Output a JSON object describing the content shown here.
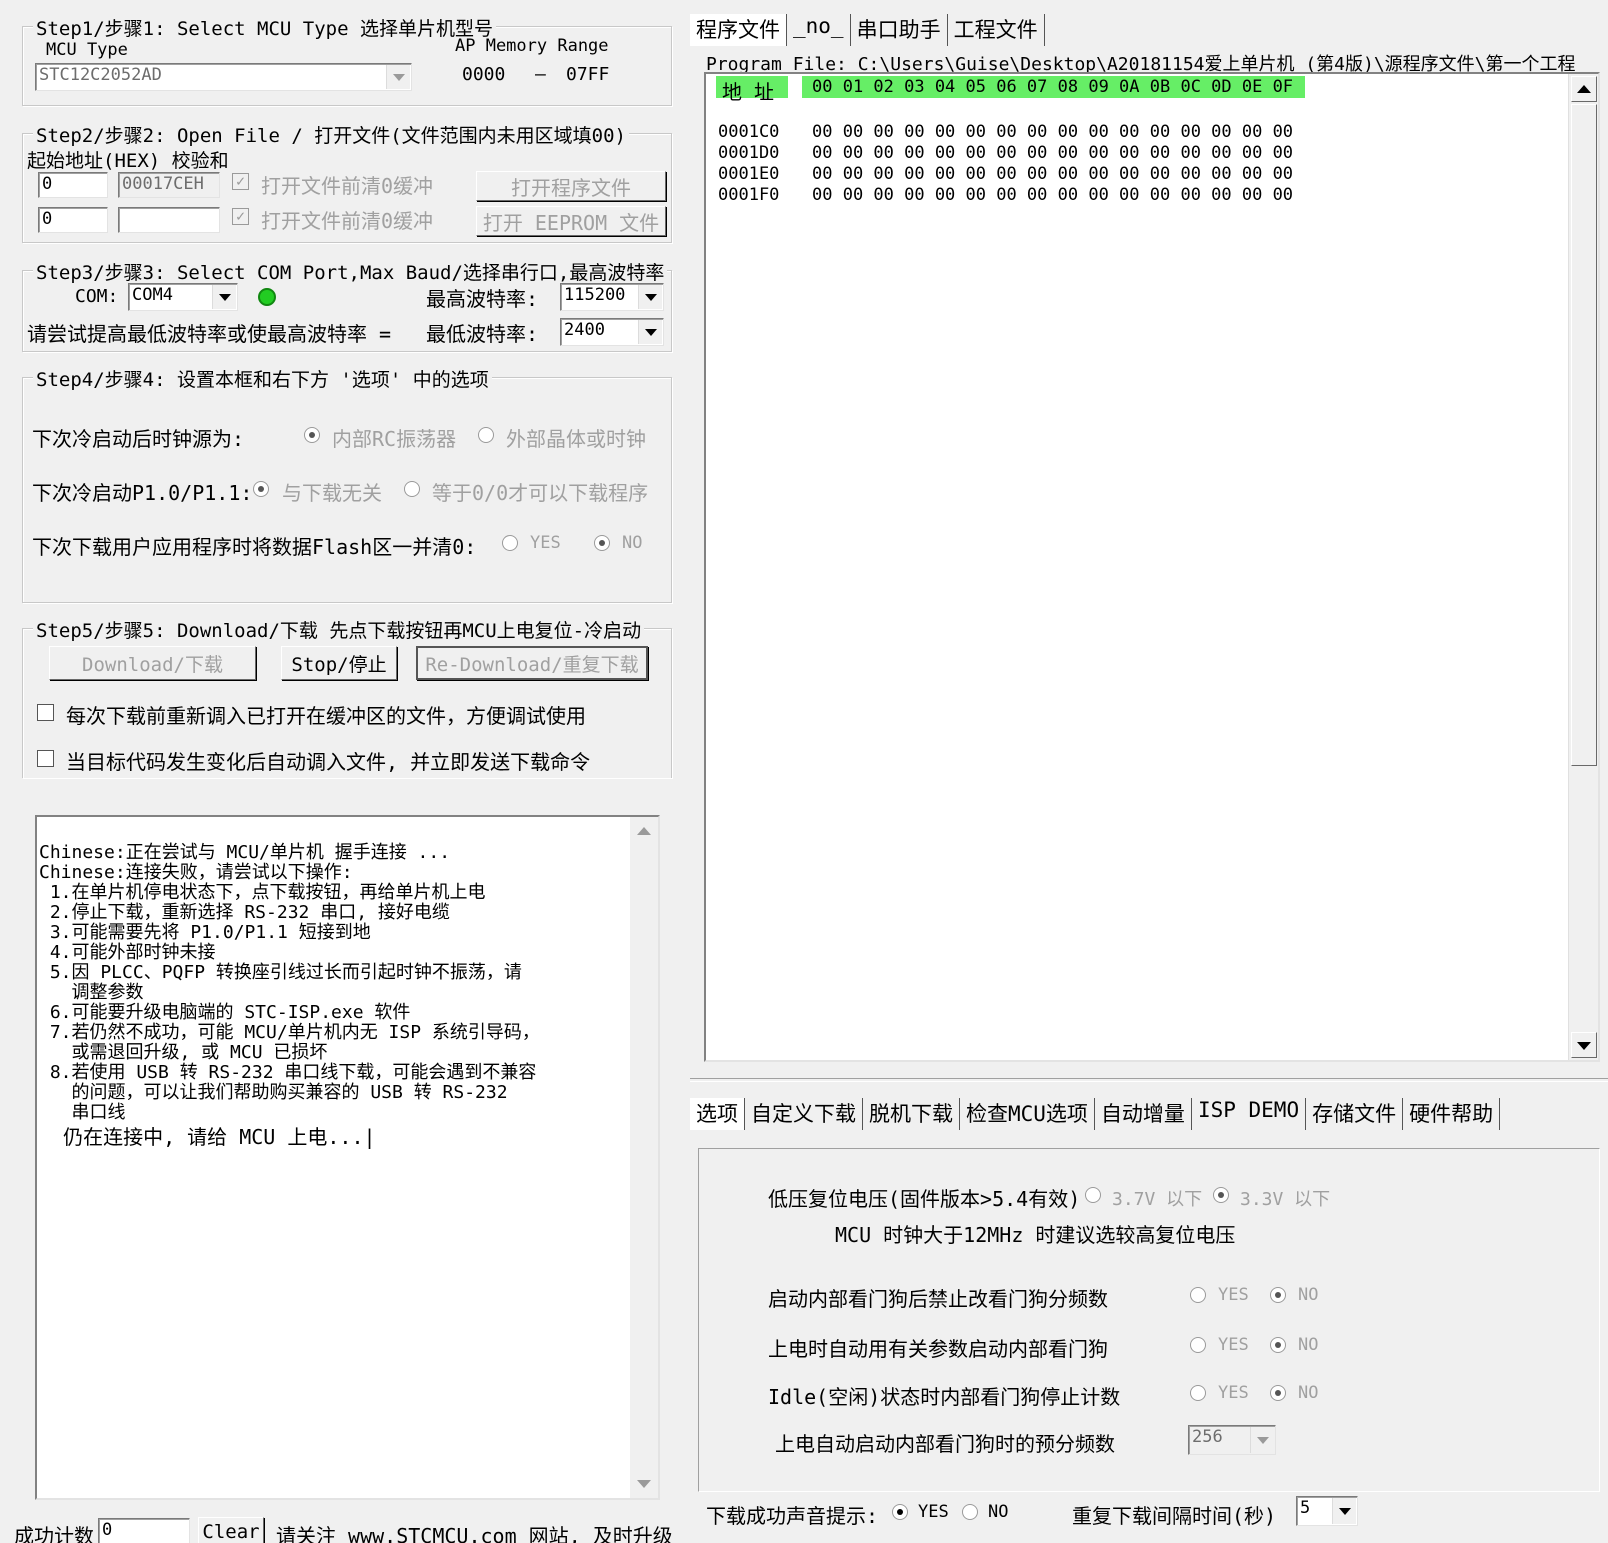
{
  "step1": {
    "title": "Step1/步骤1: Select MCU Type  选择单片机型号",
    "mcu_type_label": "MCU Type",
    "mcu_type_value": "STC12C2052AD",
    "ap_label": "AP Memory Range",
    "ap_start": "0000",
    "ap_dash": "–",
    "ap_end": "07FF"
  },
  "step2": {
    "title": "Step2/步骤2: Open File / 打开文件(文件范围内未用区域填00)",
    "subtitle": "起始地址(HEX) 校验和",
    "row1_start": "0",
    "row1_checksum": "00017CEH",
    "row1_check_label": "打开文件前清0缓冲",
    "row1_button": "打开程序文件",
    "row2_start": "0",
    "row2_checksum": "",
    "row2_check_label": "打开文件前清0缓冲",
    "row2_button": "打开 EEPROM 文件"
  },
  "step3": {
    "title": "Step3/步骤3: Select COM Port,Max Baud/选择串行口,最高波特率",
    "com_label": "COM:",
    "com_value": "COM4",
    "status_color": "#22cc22",
    "max_baud_label": "最高波特率:",
    "max_baud_value": "115200",
    "hint": "请尝试提高最低波特率或使最高波特率 =",
    "min_baud_label": "最低波特率:",
    "min_baud_value": "2400"
  },
  "step4": {
    "title": "Step4/步骤4: 设置本框和右下方 '选项' 中的选项",
    "row1_label": "下次冷启动后时钟源为:",
    "row1_opt1": "内部RC振荡器",
    "row1_opt2": "外部晶体或时钟",
    "row2_label": "下次冷启动P1.0/P1.1:",
    "row2_opt1": "与下载无关",
    "row2_opt2": "等于0/0才可以下载程序",
    "row3_label": "下次下载用户应用程序时将数据Flash区一并清0:",
    "row3_opt1": "YES",
    "row3_opt2": "NO"
  },
  "step5": {
    "title": "Step5/步骤5: Download/下载  先点下载按钮再MCU上电复位-冷启动",
    "download_btn": "Download/下载",
    "stop_btn": "Stop/停止",
    "redownload_btn": "Re-Download/重复下载",
    "check1": "每次下载前重新调入已打开在缓冲区的文件，方便调试使用",
    "check2": "当目标代码发生变化后自动调入文件, 并立即发送下载命令"
  },
  "log": {
    "lines": [
      "Chinese:正在尝试与 MCU/单片机 握手连接 ...",
      "Chinese:连接失败，请尝试以下操作:",
      " 1.在单片机停电状态下，点下载按钮，再给单片机上电",
      " 2.停止下载，重新选择 RS-232 串口, 接好电缆",
      " 3.可能需要先将 P1.0/P1.1 短接到地",
      " 4.可能外部时钟未接",
      " 5.因 PLCC、PQFP 转换座引线过长而引起时钟不振荡，请",
      "   调整参数",
      " 6.可能要升级电脑端的 STC-ISP.exe 软件",
      " 7.若仍然不成功，可能 MCU/单片机内无 ISP 系统引导码，",
      "   或需退回升级, 或 MCU 已损坏",
      " 8.若使用 USB 转 RS-232 串口线下载，可能会遇到不兼容",
      "   的问题，可以让我们帮助购买兼容的 USB 转 RS-232",
      "   串口线",
      "",
      "  仍在连接中, 请给 MCU 上电...|"
    ]
  },
  "footer": {
    "count_label": "成功计数",
    "count_value": "0",
    "clear_btn": "Clear",
    "notice": "请关注 www.STCMCU.com 网站, 及时升级"
  },
  "top_tabs": [
    "程序文件",
    "_no_",
    "串口助手",
    "工程文件"
  ],
  "program_file": {
    "label": "Program File: C:\\Users\\Guise\\Desktop\\A20181154爱上单片机 (第4版)\\源程序文件\\第一个工程",
    "header_addr": "地 址",
    "header_cols": "00 01 02 03 04 05 06 07 08 09 0A 0B 0C 0D 0E 0F",
    "header_color": "#66ee66",
    "rows": [
      {
        "addr": "0001C0",
        "bytes": "00 00 00 00 00 00 00 00 00 00 00 00 00 00 00 00"
      },
      {
        "addr": "0001D0",
        "bytes": "00 00 00 00 00 00 00 00 00 00 00 00 00 00 00 00"
      },
      {
        "addr": "0001E0",
        "bytes": "00 00 00 00 00 00 00 00 00 00 00 00 00 00 00 00"
      },
      {
        "addr": "0001F0",
        "bytes": "00 00 00 00 00 00 00 00 00 00 00 00 00 00 00 00"
      }
    ]
  },
  "bottom_tabs": [
    "选项",
    "自定义下载",
    "脱机下载",
    "检查MCU选项",
    "自动增量",
    "ISP DEMO",
    "存储文件",
    "硬件帮助"
  ],
  "options": {
    "lvr_label": "低压复位电压(固件版本>5.4有效)",
    "lvr_opt1": "3.7V 以下",
    "lvr_opt2": "3.3V 以下",
    "lvr_note": "MCU 时钟大于12MHz 时建议选较高复位电压",
    "wdt1_label": "启动内部看门狗后禁止改看门狗分频数",
    "wdt2_label": "上电时自动用有关参数启动内部看门狗",
    "wdt3_label": "Idle(空闲)状态时内部看门狗停止计数",
    "yes": "YES",
    "no": "NO",
    "prescale_label": "上电自动启动内部看门狗时的预分频数",
    "prescale_value": "256",
    "sound_label": "下载成功声音提示:",
    "sound_yes": "YES",
    "sound_no": "NO",
    "interval_label": "重复下载间隔时间(秒)",
    "interval_value": "5"
  }
}
